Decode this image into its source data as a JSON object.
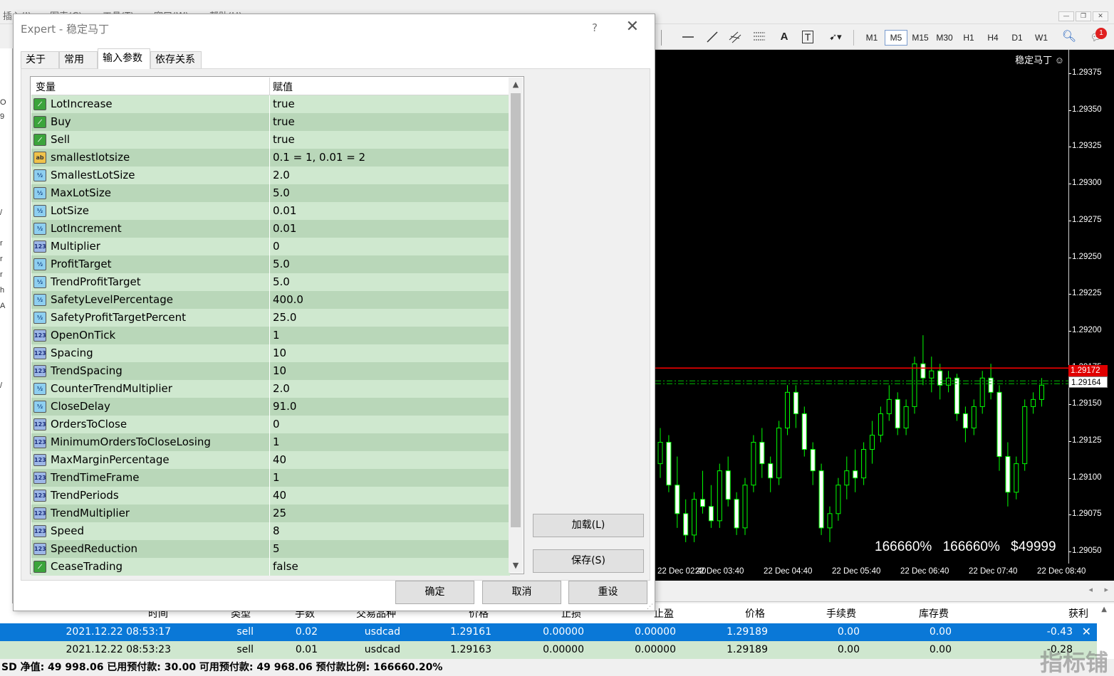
{
  "menu": [
    {
      "label": "插入(I)"
    },
    {
      "label": "图表(C)"
    },
    {
      "label": "工具(T)"
    },
    {
      "label": "窗口(W)"
    },
    {
      "label": "帮助(H)"
    }
  ],
  "toolbar": {
    "text_tool": "A",
    "label_tool": "T",
    "timeframes": [
      "M1",
      "M5",
      "M15",
      "M30",
      "H1",
      "H4",
      "D1",
      "W1"
    ],
    "selected_timeframe": "M5",
    "notification_count": "1"
  },
  "left_strip": [
    {
      "label": "O"
    },
    {
      "label": "9"
    },
    {
      "label": "/"
    },
    {
      "label": "r"
    },
    {
      "label": "r"
    },
    {
      "label": "r"
    },
    {
      "label": "h"
    },
    {
      "label": "A"
    },
    {
      "label": "/"
    }
  ],
  "dialog": {
    "title": "Expert - 稳定马丁",
    "help": "?",
    "close": "✕",
    "tabs": [
      {
        "label": "关于"
      },
      {
        "label": "常用"
      },
      {
        "label": "输入参数"
      },
      {
        "label": "依存关系"
      }
    ],
    "active_tab": 2,
    "grid": {
      "col_variable": "变量",
      "col_value": "赋值",
      "rows": [
        {
          "type": "bool",
          "icon": "bool-icon",
          "name": "LotIncrease",
          "value": "true"
        },
        {
          "type": "bool",
          "icon": "bool-icon",
          "name": "Buy",
          "value": "true"
        },
        {
          "type": "bool",
          "icon": "bool-icon",
          "name": "Sell",
          "value": "true"
        },
        {
          "type": "str",
          "icon": "string-icon",
          "name": "smallestlotsize",
          "value": "0.1 = 1, 0.01 = 2"
        },
        {
          "type": "dbl",
          "icon": "double-icon",
          "name": "SmallestLotSize",
          "value": "2.0"
        },
        {
          "type": "dbl",
          "icon": "double-icon",
          "name": "MaxLotSize",
          "value": "5.0"
        },
        {
          "type": "dbl",
          "icon": "double-icon",
          "name": "LotSize",
          "value": "0.01"
        },
        {
          "type": "dbl",
          "icon": "double-icon",
          "name": "LotIncrement",
          "value": "0.01"
        },
        {
          "type": "int",
          "icon": "integer-icon",
          "name": "Multiplier",
          "value": "0"
        },
        {
          "type": "dbl",
          "icon": "double-icon",
          "name": "ProfitTarget",
          "value": "5.0"
        },
        {
          "type": "dbl",
          "icon": "double-icon",
          "name": "TrendProfitTarget",
          "value": "5.0"
        },
        {
          "type": "dbl",
          "icon": "double-icon",
          "name": "SafetyLevelPercentage",
          "value": "400.0"
        },
        {
          "type": "dbl",
          "icon": "double-icon",
          "name": "SafetyProfitTargetPercent",
          "value": "25.0"
        },
        {
          "type": "int",
          "icon": "integer-icon",
          "name": "OpenOnTick",
          "value": "1"
        },
        {
          "type": "int",
          "icon": "integer-icon",
          "name": "Spacing",
          "value": "10"
        },
        {
          "type": "int",
          "icon": "integer-icon",
          "name": "TrendSpacing",
          "value": "10"
        },
        {
          "type": "dbl",
          "icon": "double-icon",
          "name": "CounterTrendMultiplier",
          "value": "2.0"
        },
        {
          "type": "dbl",
          "icon": "double-icon",
          "name": "CloseDelay",
          "value": "91.0"
        },
        {
          "type": "int",
          "icon": "integer-icon",
          "name": "OrdersToClose",
          "value": "0"
        },
        {
          "type": "int",
          "icon": "integer-icon",
          "name": "MinimumOrdersToCloseLosing",
          "value": "1"
        },
        {
          "type": "int",
          "icon": "integer-icon",
          "name": "MaxMarginPercentage",
          "value": "40"
        },
        {
          "type": "int",
          "icon": "integer-icon",
          "name": "TrendTimeFrame",
          "value": "1"
        },
        {
          "type": "int",
          "icon": "integer-icon",
          "name": "TrendPeriods",
          "value": "40"
        },
        {
          "type": "int",
          "icon": "integer-icon",
          "name": "TrendMultiplier",
          "value": "25"
        },
        {
          "type": "int",
          "icon": "integer-icon",
          "name": "Speed",
          "value": "8"
        },
        {
          "type": "int",
          "icon": "integer-icon",
          "name": "SpeedReduction",
          "value": "5"
        },
        {
          "type": "bool",
          "icon": "bool-icon",
          "name": "CeaseTrading",
          "value": "false"
        }
      ]
    },
    "icon_glyphs": {
      "bool": "⟋",
      "str": "ab",
      "dbl": "½",
      "int": "123"
    },
    "buttons": {
      "load": "加载(L)",
      "save": "保存(S)",
      "ok": "确定",
      "cancel": "取消",
      "reset": "重设"
    }
  },
  "chart": {
    "name": "稳定马丁 ☺",
    "price_ticks": [
      "1.29375",
      "1.29350",
      "1.29325",
      "1.29300",
      "1.29275",
      "1.29250",
      "1.29225",
      "1.29200",
      "1.29175",
      "1.29150",
      "1.29125",
      "1.29100",
      "1.29075",
      "1.29050"
    ],
    "bid_price": "1.29172",
    "ask_price": "1.29164",
    "time_labels": [
      "22 Dec 02:40",
      "22 Dec 03:40",
      "22 Dec 04:40",
      "22 Dec 05:40",
      "22 Dec 06:40",
      "22 Dec 07:40",
      "22 Dec 08:40"
    ],
    "stats": "166660%  166660%  $49999",
    "colors": {
      "bull": "#000000",
      "bear": "#ffffff",
      "wick": "#00ff00",
      "bid_line": "#ff0000",
      "order_line": "#00c000"
    },
    "price_range": [
      1.29035,
      1.29395
    ],
    "candles": [
      {
        "o": 1.29105,
        "h": 1.2913,
        "l": 1.29095,
        "c": 1.2912
      },
      {
        "o": 1.2912,
        "h": 1.29125,
        "l": 1.29085,
        "c": 1.2909
      },
      {
        "o": 1.2909,
        "h": 1.2911,
        "l": 1.2906,
        "c": 1.2907
      },
      {
        "o": 1.2907,
        "h": 1.2908,
        "l": 1.2905,
        "c": 1.29055
      },
      {
        "o": 1.29055,
        "h": 1.29085,
        "l": 1.2905,
        "c": 1.2908
      },
      {
        "o": 1.2908,
        "h": 1.291,
        "l": 1.2907,
        "c": 1.29075
      },
      {
        "o": 1.29075,
        "h": 1.2909,
        "l": 1.2906,
        "c": 1.29065
      },
      {
        "o": 1.29065,
        "h": 1.29105,
        "l": 1.2906,
        "c": 1.291
      },
      {
        "o": 1.291,
        "h": 1.2911,
        "l": 1.29075,
        "c": 1.2908
      },
      {
        "o": 1.2908,
        "h": 1.29085,
        "l": 1.29055,
        "c": 1.2906
      },
      {
        "o": 1.2906,
        "h": 1.29095,
        "l": 1.29055,
        "c": 1.2909
      },
      {
        "o": 1.2909,
        "h": 1.29125,
        "l": 1.29085,
        "c": 1.2912
      },
      {
        "o": 1.2912,
        "h": 1.2913,
        "l": 1.29095,
        "c": 1.29105
      },
      {
        "o": 1.29105,
        "h": 1.2911,
        "l": 1.29085,
        "c": 1.29095
      },
      {
        "o": 1.29095,
        "h": 1.29135,
        "l": 1.2909,
        "c": 1.2913
      },
      {
        "o": 1.2913,
        "h": 1.2916,
        "l": 1.29125,
        "c": 1.29155
      },
      {
        "o": 1.29155,
        "h": 1.2916,
        "l": 1.2913,
        "c": 1.2914
      },
      {
        "o": 1.2914,
        "h": 1.29145,
        "l": 1.2911,
        "c": 1.29115
      },
      {
        "o": 1.29115,
        "h": 1.2912,
        "l": 1.2909,
        "c": 1.291
      },
      {
        "o": 1.291,
        "h": 1.29105,
        "l": 1.29055,
        "c": 1.2906
      },
      {
        "o": 1.2906,
        "h": 1.29075,
        "l": 1.2905,
        "c": 1.2907
      },
      {
        "o": 1.2907,
        "h": 1.29095,
        "l": 1.29065,
        "c": 1.2909
      },
      {
        "o": 1.2909,
        "h": 1.2911,
        "l": 1.2908,
        "c": 1.291
      },
      {
        "o": 1.291,
        "h": 1.29115,
        "l": 1.29085,
        "c": 1.29095
      },
      {
        "o": 1.29095,
        "h": 1.2912,
        "l": 1.2909,
        "c": 1.29115
      },
      {
        "o": 1.29115,
        "h": 1.29135,
        "l": 1.29105,
        "c": 1.29125
      },
      {
        "o": 1.29125,
        "h": 1.29145,
        "l": 1.2912,
        "c": 1.2914
      },
      {
        "o": 1.2914,
        "h": 1.2916,
        "l": 1.29135,
        "c": 1.2915
      },
      {
        "o": 1.2915,
        "h": 1.29155,
        "l": 1.29125,
        "c": 1.2913
      },
      {
        "o": 1.2913,
        "h": 1.2915,
        "l": 1.29125,
        "c": 1.29145
      },
      {
        "o": 1.29145,
        "h": 1.2918,
        "l": 1.2914,
        "c": 1.29175
      },
      {
        "o": 1.29175,
        "h": 1.29195,
        "l": 1.2916,
        "c": 1.29165
      },
      {
        "o": 1.29165,
        "h": 1.2918,
        "l": 1.29155,
        "c": 1.2917
      },
      {
        "o": 1.2917,
        "h": 1.29175,
        "l": 1.2915,
        "c": 1.2916
      },
      {
        "o": 1.2916,
        "h": 1.2917,
        "l": 1.29155,
        "c": 1.29165
      },
      {
        "o": 1.29165,
        "h": 1.29168,
        "l": 1.29135,
        "c": 1.2914
      },
      {
        "o": 1.2914,
        "h": 1.29145,
        "l": 1.2912,
        "c": 1.2913
      },
      {
        "o": 1.2913,
        "h": 1.2915,
        "l": 1.29125,
        "c": 1.29145
      },
      {
        "o": 1.29145,
        "h": 1.2917,
        "l": 1.2914,
        "c": 1.29165
      },
      {
        "o": 1.29165,
        "h": 1.29175,
        "l": 1.2915,
        "c": 1.29155
      },
      {
        "o": 1.29155,
        "h": 1.2916,
        "l": 1.291,
        "c": 1.2911
      },
      {
        "o": 1.2911,
        "h": 1.2912,
        "l": 1.29075,
        "c": 1.29085
      },
      {
        "o": 1.29085,
        "h": 1.2911,
        "l": 1.2908,
        "c": 1.29105
      },
      {
        "o": 1.29105,
        "h": 1.2915,
        "l": 1.291,
        "c": 1.29145
      },
      {
        "o": 1.29145,
        "h": 1.29155,
        "l": 1.2914,
        "c": 1.2915
      },
      {
        "o": 1.2915,
        "h": 1.29165,
        "l": 1.29145,
        "c": 1.2916
      }
    ]
  },
  "terminal": {
    "columns": [
      {
        "label": "时间"
      },
      {
        "label": "类型"
      },
      {
        "label": "手数"
      },
      {
        "label": "交易品种"
      },
      {
        "label": "价格"
      },
      {
        "label": "止损"
      },
      {
        "label": "止盈"
      },
      {
        "label": "价格"
      },
      {
        "label": "手续费"
      },
      {
        "label": "库存费"
      },
      {
        "label": "获利"
      }
    ],
    "rows": [
      {
        "time": "2021.12.22 08:53:17",
        "type": "sell",
        "lots": "0.02",
        "symbol": "usdcad",
        "price": "1.29161",
        "sl": "0.00000",
        "tp": "0.00000",
        "cur_price": "1.29189",
        "commission": "0.00",
        "swap": "0.00",
        "profit": "-0.43"
      },
      {
        "time": "2021.12.22 08:53:23",
        "type": "sell",
        "lots": "0.01",
        "symbol": "usdcad",
        "price": "1.29163",
        "sl": "0.00000",
        "tp": "0.00000",
        "cur_price": "1.29189",
        "commission": "0.00",
        "swap": "0.00",
        "profit": "-0.28"
      }
    ],
    "status": "SD  净值: 49 998.06  已用预付款: 30.00  可用预付款: 49 968.06  预付款比例: 166660.20%",
    "watermark": "指标铺"
  }
}
